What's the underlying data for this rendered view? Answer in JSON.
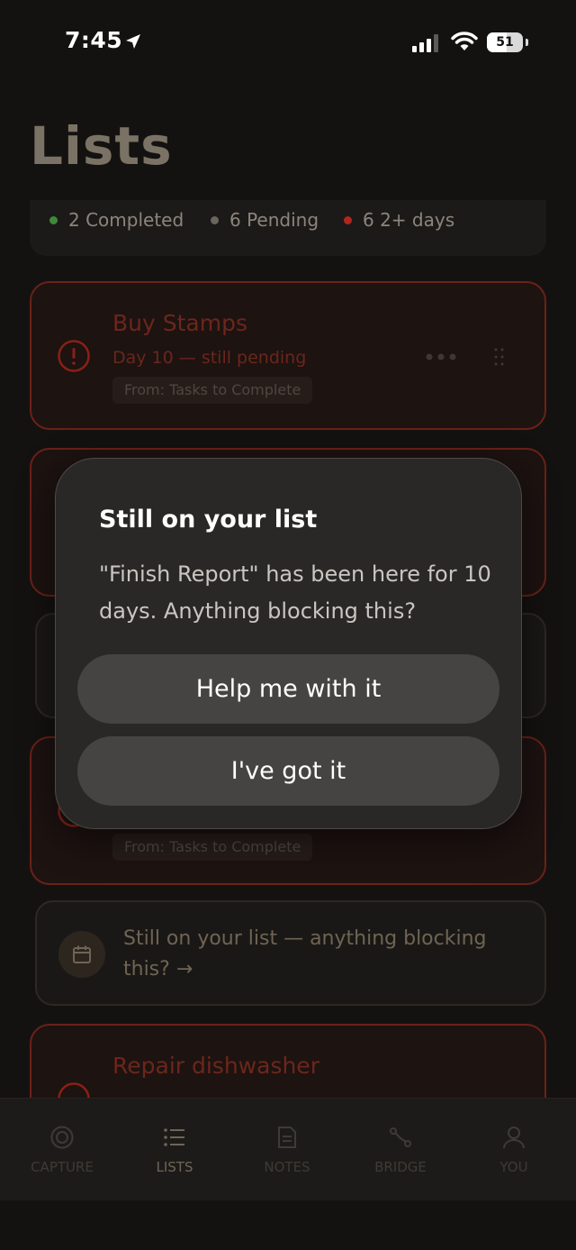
{
  "status_bar": {
    "time": "7:45",
    "battery": "51"
  },
  "page": {
    "title": "Lists"
  },
  "summary": {
    "completed": "2 Completed",
    "pending": "6 Pending",
    "overdue": "6 2+ days"
  },
  "cards": [
    {
      "title": "Buy Stamps",
      "subtitle": "Day 10 — still pending",
      "tag": "From: Tasks to Complete"
    },
    {
      "tag": "From: Tasks to Complete"
    },
    {
      "title": "Repair dishwasher"
    }
  ],
  "nudge": {
    "text": "Still on your list — anything blocking this? →"
  },
  "modal": {
    "title": "Still on your list",
    "body": "\"Finish Report\" has been here for 10 days. Anything blocking this?",
    "primary_button": "Help me with it",
    "secondary_button": "I've got it"
  },
  "tabs": [
    {
      "label": "CAPTURE",
      "icon": "target-icon"
    },
    {
      "label": "LISTS",
      "icon": "list-icon",
      "active": true
    },
    {
      "label": "NOTES",
      "icon": "notes-icon"
    },
    {
      "label": "BRIDGE",
      "icon": "bridge-icon"
    },
    {
      "label": "YOU",
      "icon": "user-icon"
    }
  ],
  "colors": {
    "completed_dot": "#3f8a3a",
    "pending_dot": "#6a665f",
    "overdue_dot": "#b3261e",
    "card_border": "#6b2118",
    "modal_bg": "#2a2826"
  }
}
